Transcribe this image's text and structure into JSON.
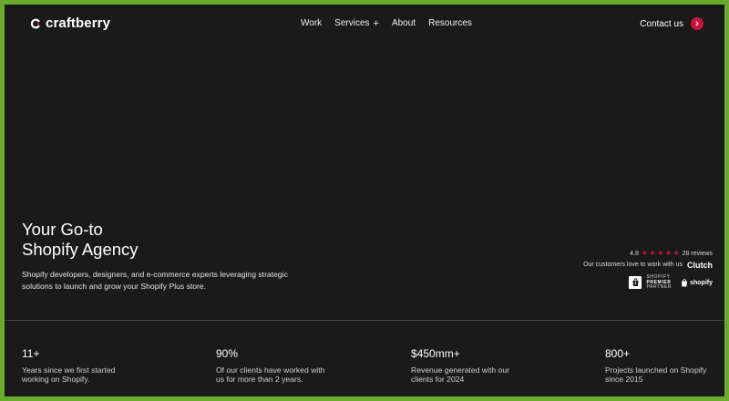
{
  "brand": {
    "name": "craftberry"
  },
  "nav": {
    "items": [
      {
        "label": "Work"
      },
      {
        "label": "Services"
      },
      {
        "label": "About"
      },
      {
        "label": "Resources"
      }
    ],
    "services_expand_glyph": "+"
  },
  "contact": {
    "label": "Contact us"
  },
  "hero": {
    "title_line1": "Your Go-to",
    "title_line2": "Shopify Agency",
    "subtitle": "Shopify developers, designers, and e-commerce experts leveraging strategic solutions to launch and grow your Shopify Plus store."
  },
  "reviews": {
    "rating": "4.8",
    "stars": 5,
    "count": "28 reviews",
    "tagline": "Our customers love to work with us",
    "platform": "Clutch"
  },
  "badges": {
    "partner_line1": "SHOPIFY",
    "partner_line2": "PREMIER",
    "partner_line3": "PARTNER",
    "shopify": "shopify"
  },
  "stats": [
    {
      "value": "11+",
      "label": "Years since we first started working on Shopify."
    },
    {
      "value": "90%",
      "label": "Of our clients have worked with us for more than 2 years."
    },
    {
      "value": "$450mm+",
      "label": "Revenue generated with our clients for 2024"
    },
    {
      "value": "800+",
      "label": "Projects launched on Shopify since 2015"
    }
  ],
  "colors": {
    "accent": "#c8123f",
    "background": "#1a1a1a",
    "frame": "#6aab2e"
  },
  "icons": {
    "logo": "craftberry-logo-icon",
    "contact_arrow": "chevron-right-icon",
    "star": "star-icon",
    "shopify_bag": "shopify-bag-icon"
  }
}
